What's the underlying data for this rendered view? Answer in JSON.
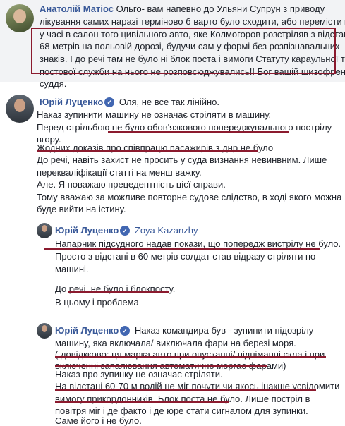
{
  "comments": [
    {
      "author": "Анатолій Матіос",
      "lines": [
        "Ольго- вам напевно до Ульяни Супрун з приводу",
        "лікування самих наразі терміново б варто було сходити, або переміститися",
        "у часі в салон того цивільного авто, яке Колмогоров розстріляв з відстані",
        "68 метрів на польовій дорозі, будучи сам у формі без розпізнавальних",
        "знаків. І до речі там не було ні блок поста і вимоги Статуту караульної та",
        "постової служби на нього не розповсюджувались!! Бог вашій шизофренії",
        "суддя."
      ]
    },
    {
      "author": "Юрій Луценко",
      "lines": [
        "Оля, не все так лінійно.",
        "Наказ зупинити машину не означає стріляти в машину.",
        "Перед стрільбою не було обов'язкового попереджувального пострілу",
        "вгору.",
        "Жодних доказів про співпрацю пасажирів з днр не було",
        "До речі, навіть захист не просить у суда визнання невинвним. Лише",
        "перекваліфікації статті на менш важку.",
        "Але. Я поважаю прецедентність цієї справи.",
        "Тому вважаю за можливе повторне судове слідство, в ході якого можна",
        "буде вийти на істину."
      ]
    },
    {
      "author": "Юрій Луценко",
      "tag": "Zoya Kazanzhy",
      "lines": [
        "Напарник підсудного надав покази, що попередж вистрілу не було.",
        "Просто з відстані в 60 метрів солдат став відразу стріляти по",
        "машині.",
        "",
        "До речі, не було і блокпосту.",
        "",
        "В цьому і проблема"
      ]
    },
    {
      "author": "Юрій Луценко",
      "lines": [
        "Наказ командира був - зупинити підозрілу",
        "машину, яка включала/ виключала фари на березі моря.",
        "( довідкково: ця марка авто при опусканні/ підніманні скла і при",
        "включенні запалювання автоматично моргає фарами)",
        "Наказ про зупинку не означає стріляти.",
        "На відстані 60-70 м водій не міг почути чи якось інакше усвідомити",
        "вимогу прикордонників. Блок поста не було. Лише постріл в",
        "повітря міг і де факто і де юре стати сигналом для зупинки.",
        "Саме його і не було."
      ]
    }
  ],
  "colors": {
    "author": "#385898",
    "highlight": "#8b1a2e",
    "bubble": "#f2f3f5",
    "verified": "#4267b2"
  },
  "icons": [
    "verified-badge-icon",
    "avatar"
  ]
}
